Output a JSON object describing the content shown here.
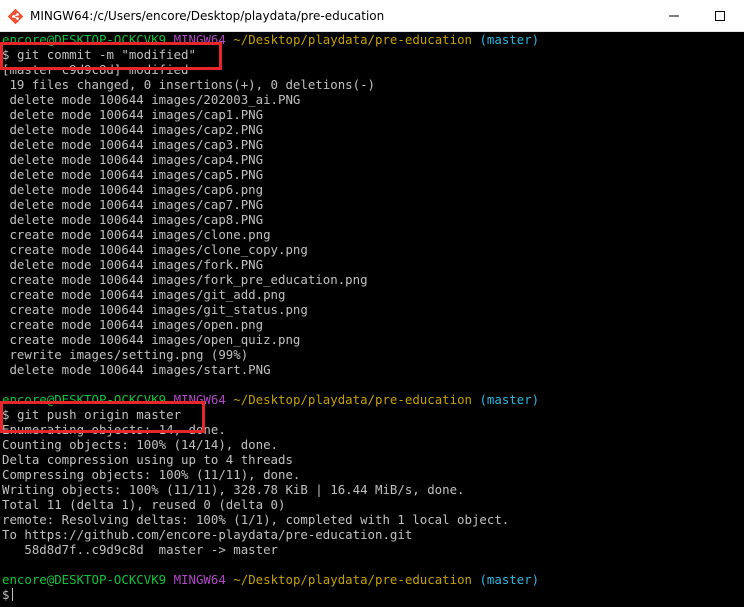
{
  "window": {
    "title": "MINGW64:/c/Users/encore/Desktop/playdata/pre-education",
    "controls": {
      "minimize": "—",
      "maximize": "☐",
      "close": "✕"
    }
  },
  "prompt": {
    "user_host": "encore@DESKTOP-OCKCVK9",
    "system": "MINGW64",
    "path": "~/Desktop/playdata/pre-education",
    "branch": "(master)",
    "symbol": "$"
  },
  "commit": {
    "command": "git commit -m \"modified\"",
    "summary": "[master c9d9c8d] modified",
    "stats": " 19 files changed, 0 insertions(+), 0 deletions(-)",
    "files": [
      " delete mode 100644 images/202003_ai.PNG",
      " delete mode 100644 images/cap1.PNG",
      " delete mode 100644 images/cap2.PNG",
      " delete mode 100644 images/cap3.PNG",
      " delete mode 100644 images/cap4.PNG",
      " delete mode 100644 images/cap5.PNG",
      " delete mode 100644 images/cap6.png",
      " delete mode 100644 images/cap7.PNG",
      " delete mode 100644 images/cap8.PNG",
      " create mode 100644 images/clone.png",
      " create mode 100644 images/clone_copy.png",
      " delete mode 100644 images/fork.PNG",
      " create mode 100644 images/fork_pre_education.png",
      " create mode 100644 images/git_add.png",
      " create mode 100644 images/git_status.png",
      " create mode 100644 images/open.png",
      " create mode 100644 images/open_quiz.png",
      " rewrite images/setting.png (99%)",
      " delete mode 100644 images/start.PNG"
    ]
  },
  "push": {
    "command": "git push origin master",
    "output": [
      "Enumerating objects: 14, done.",
      "Counting objects: 100% (14/14), done.",
      "Delta compression using up to 4 threads",
      "Compressing objects: 100% (11/11), done.",
      "Writing objects: 100% (11/11), 328.78 KiB | 16.44 MiB/s, done.",
      "Total 11 (delta 1), reused 0 (delta 0)",
      "remote: Resolving deltas: 100% (1/1), completed with 1 local object.",
      "To https://github.com/encore-playdata/pre-education.git",
      "   58d8d7f..c9d9c8d  master -> master"
    ]
  },
  "highlight_color": "#e5262b"
}
